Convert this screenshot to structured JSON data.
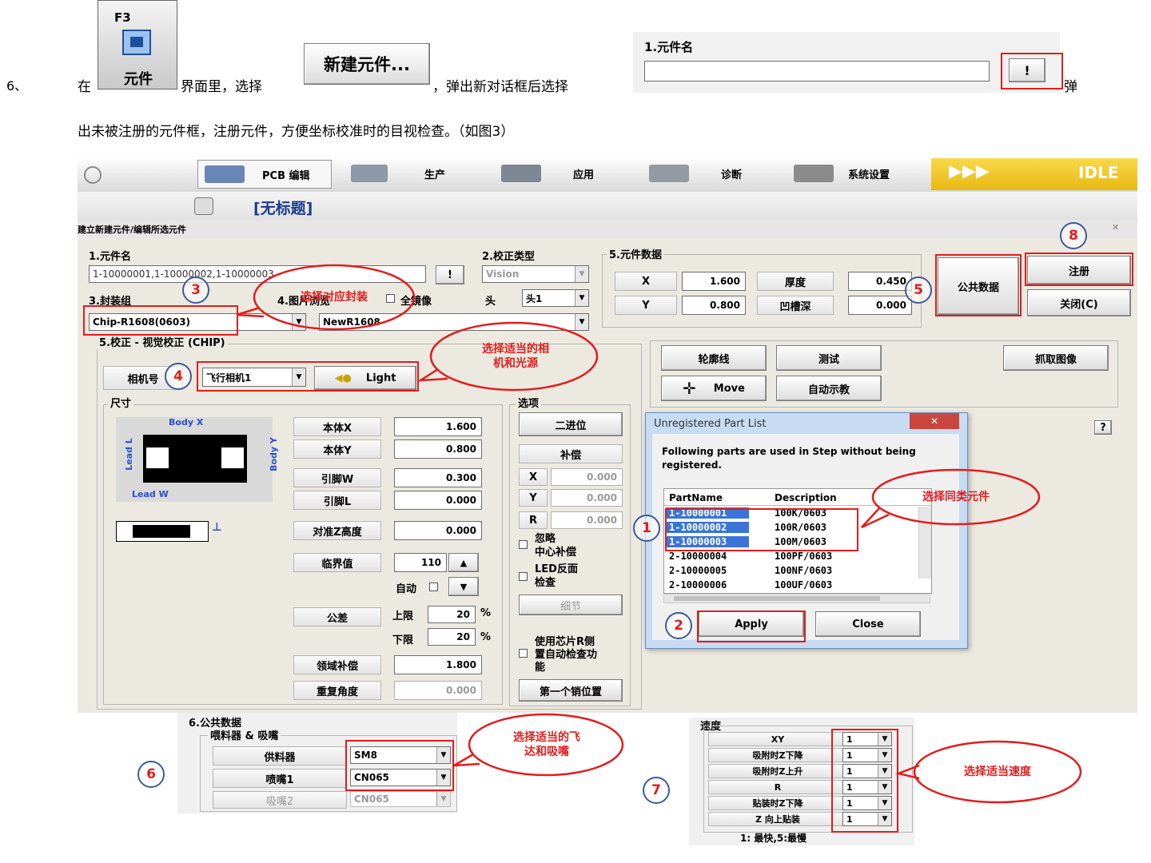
{
  "intro": {
    "step_no": "6、",
    "seg_zai": "在",
    "seg_jiemian": "界面里，选择",
    "seg_tanchu": "，弹出新对话框后选择",
    "seg_tan": "弹",
    "line2": "出未被注册的元件框，注册元件，方便坐标校准时的目视检查。（如图3）",
    "f3_key": "F3",
    "f3_label": "元件",
    "new_part_button": "新建元件...",
    "mini_label": "1.元件名",
    "mini_button": "!"
  },
  "app": {
    "tabs": [
      "PCB 编辑",
      "生产",
      "应用",
      "诊断",
      "系统设置"
    ],
    "status": "IDLE",
    "doc_title": "[无标题]",
    "dialog_title": "建立新建元件/编辑所选元件",
    "close_x": "✕"
  },
  "part_name": {
    "label": "1.元件名",
    "value": "1-10000001,1-10000002,1-10000003",
    "button": "!"
  },
  "calib_type": {
    "label": "2.校正类型",
    "value": "Vision"
  },
  "package": {
    "label": "3.封装组",
    "value": "Chip-R1608(0603)"
  },
  "image_source": {
    "label": "4.图片浏览",
    "mirror_label": "全镜像",
    "head_label": "头",
    "head_value": "头1",
    "image_value": "NewR1608"
  },
  "part_data": {
    "title": "5.元件数据",
    "x_label": "X",
    "x_value": "1.600",
    "y_label": "Y",
    "y_value": "0.800",
    "thickness_label": "厚度",
    "thickness_value": "0.450",
    "groove_label": "凹槽深",
    "groove_value": "0.000",
    "common_data_btn": "公共数据",
    "register_btn": "注册",
    "close_btn": "关闭(C)"
  },
  "vision": {
    "title": "5.校正 - 视觉校正 (CHIP)",
    "camera_label": "相机号",
    "camera_value": "飞行相机1",
    "light_label": "Light",
    "tools": {
      "outline": "轮廓线",
      "test": "测试",
      "capture": "抓取图像",
      "move": "Move",
      "auto_teach": "自动示教"
    },
    "help": "?"
  },
  "size": {
    "title": "尺寸",
    "diagram": {
      "body_x": "Body X",
      "body_y": "Body Y",
      "lead_l": "Lead L",
      "lead_w": "Lead W"
    },
    "rows": [
      {
        "label": "本体X",
        "value": "1.600"
      },
      {
        "label": "本体Y",
        "value": "0.800"
      },
      {
        "label": "引脚W",
        "value": "0.300"
      },
      {
        "label": "引脚L",
        "value": "0.000"
      },
      {
        "label": "对准Z高度",
        "value": "0.000"
      }
    ],
    "threshold_label": "临界值",
    "threshold_value": "110",
    "auto_label": "自动",
    "tolerance_label": "公差",
    "upper_label": "上限",
    "upper_value": "20",
    "lower_label": "下限",
    "lower_value": "20",
    "pct": "%",
    "area_comp_label": "领域补偿",
    "area_comp_value": "1.800",
    "repeat_angle_label": "重复角度",
    "repeat_angle_value": "0.000"
  },
  "options": {
    "title": "选项",
    "binarize": "二进位",
    "compensation": "补偿",
    "x_label": "X",
    "x_value": "0.000",
    "y_label": "Y",
    "y_value": "0.000",
    "r_label": "R",
    "r_value": "0.000",
    "ignore_center": "忽略\n中心补偿",
    "led_check": "LED反面\n检查",
    "detail": "细节",
    "chip_rm": "使用芯片R侧\n置自动检查功\n能",
    "first_pin": "第一个销位置"
  },
  "unregistered": {
    "title": "Unregistered Part List",
    "close_x": "✕",
    "message": "Following parts are used in Step without being registered.",
    "col_partname": "PartName",
    "col_description": "Description",
    "rows": [
      {
        "name": "1-10000001",
        "desc": "100K/0603"
      },
      {
        "name": "1-10000002",
        "desc": "100R/0603"
      },
      {
        "name": "1-10000003",
        "desc": "100M/0603"
      },
      {
        "name": "2-10000004",
        "desc": "100PF/0603"
      },
      {
        "name": "2-10000005",
        "desc": "100NF/0603"
      },
      {
        "name": "2-10000006",
        "desc": "100UF/0603"
      }
    ],
    "apply": "Apply",
    "close": "Close"
  },
  "common": {
    "title": "6.公共数据",
    "sub": "喂料器 & 吸嘴",
    "feeder_label": "供料器",
    "feeder_value": "SM8",
    "nozzle1_label": "喷嘴1",
    "nozzle1_value": "CN065",
    "nozzle2_label": "吸嘴2",
    "nozzle2_value": "CN065"
  },
  "speed": {
    "title": "速度",
    "rows": [
      {
        "label": "XY",
        "value": "1"
      },
      {
        "label": "吸附时Z下降",
        "value": "1"
      },
      {
        "label": "吸附时Z上升",
        "value": "1"
      },
      {
        "label": "R",
        "value": "1"
      },
      {
        "label": "贴装时Z下降",
        "value": "1"
      },
      {
        "label": "Z 向上贴装",
        "value": "1"
      }
    ],
    "legend": "1: 最快,5:最慢"
  },
  "annotations": {
    "n1": "1",
    "n2": "2",
    "n3": "3",
    "n4": "4",
    "n5": "5",
    "n6": "6",
    "n7": "7",
    "n8": "8",
    "c_package": "选择对应封装",
    "c_camera": "选择适当的相\n机和光源",
    "c_parts": "选择同类元件",
    "c_feeder": "选择适当的飞\n达和吸嘴",
    "c_speed": "选择适当速度"
  },
  "colors": {
    "red": "#e11d1d",
    "select_blue": "#3a74d8",
    "status_yellow": "#f2c81e",
    "window_gray": "#ece9e0"
  }
}
